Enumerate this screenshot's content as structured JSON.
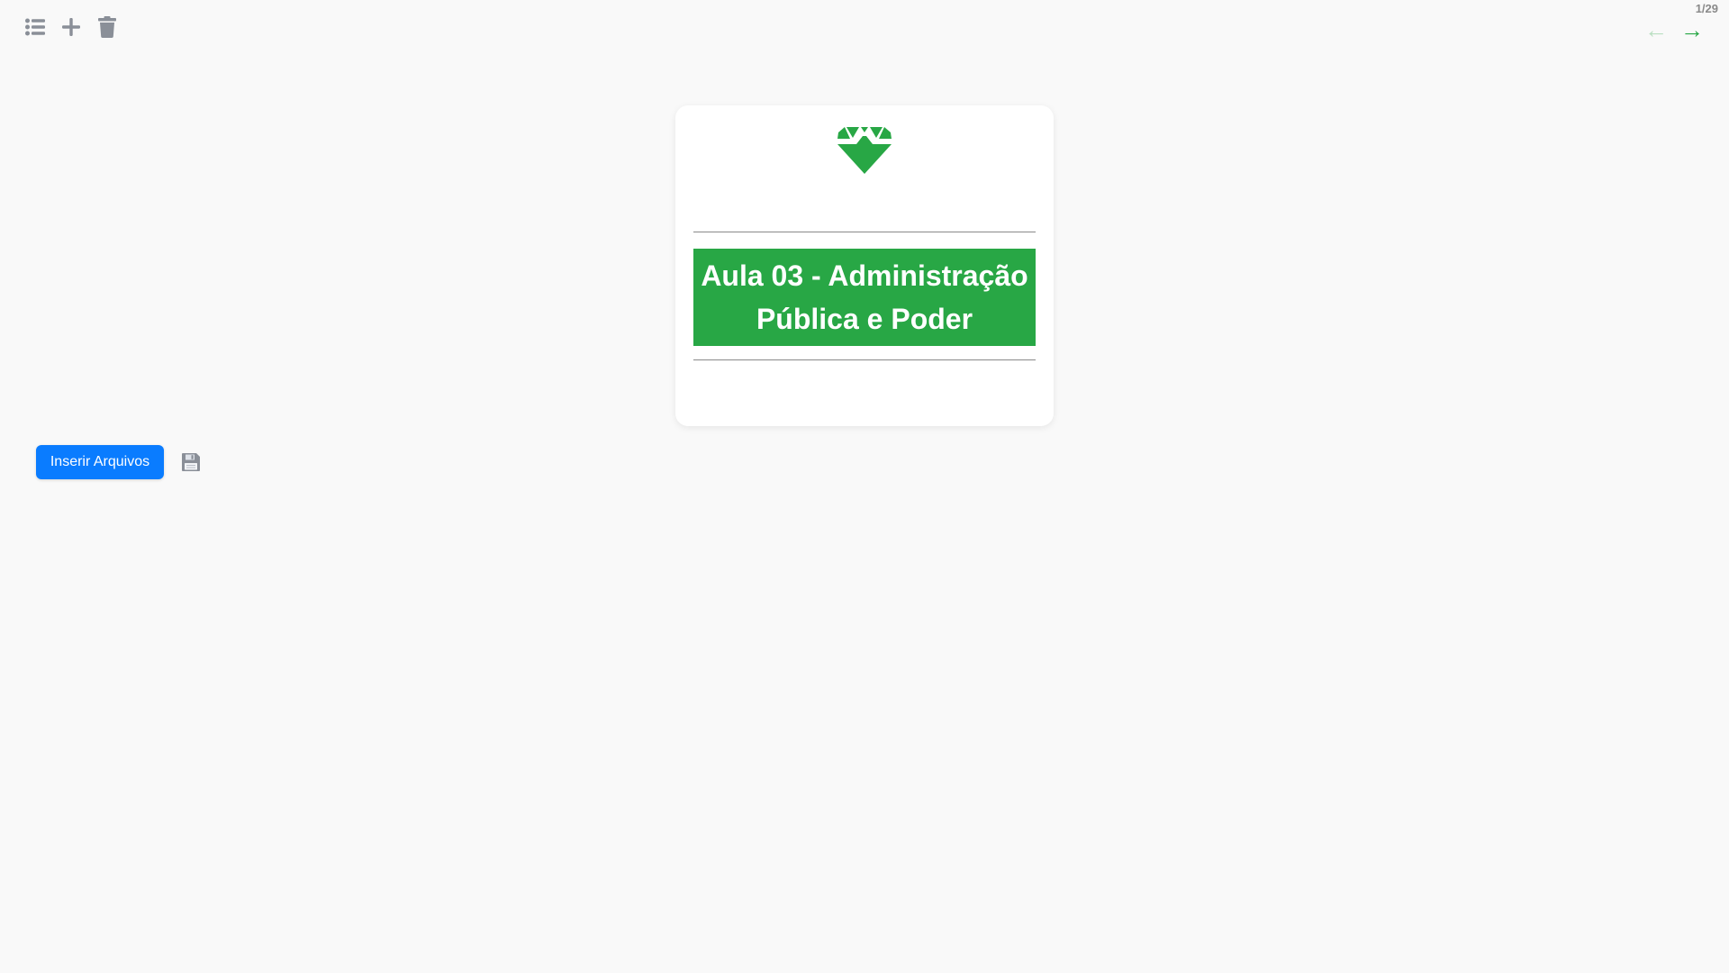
{
  "toolbar": {
    "icons": [
      "list-icon",
      "plus-icon",
      "trash-icon"
    ]
  },
  "pagination": {
    "counter": "1/29",
    "prev_arrow": "←",
    "next_arrow": "→"
  },
  "card": {
    "logo_icon": "diamond-icon",
    "title": "Aula 03 - Administração Pública e Poder"
  },
  "actions": {
    "insert_label": "Inserir Arquivos",
    "save_icon": "floppy-disk-icon"
  },
  "colors": {
    "accent_green": "#28a745",
    "primary_blue": "#0a7cff",
    "icon_gray": "#8a8f98"
  }
}
